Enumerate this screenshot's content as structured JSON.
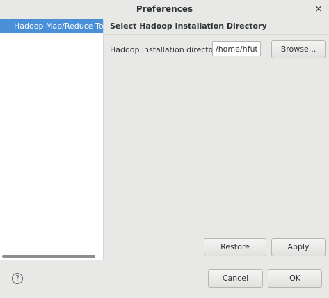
{
  "window": {
    "title": "Preferences",
    "close_glyph": "×"
  },
  "sidebar": {
    "items": [
      {
        "label": "Hadoop Map/Reduce Tools",
        "selected": true
      }
    ]
  },
  "main": {
    "heading": "Select Hadoop Installation Directory",
    "field_label": "Hadoop installation directory:",
    "directory_value": "/home/hfut/ha",
    "browse_label": "Browse...",
    "restore_label": "Restore Defaults",
    "apply_label": "Apply"
  },
  "footer": {
    "help_glyph": "?",
    "cancel_label": "Cancel",
    "ok_label": "OK"
  },
  "colors": {
    "selection": "#4a90d9",
    "background": "#e8e8e7"
  }
}
